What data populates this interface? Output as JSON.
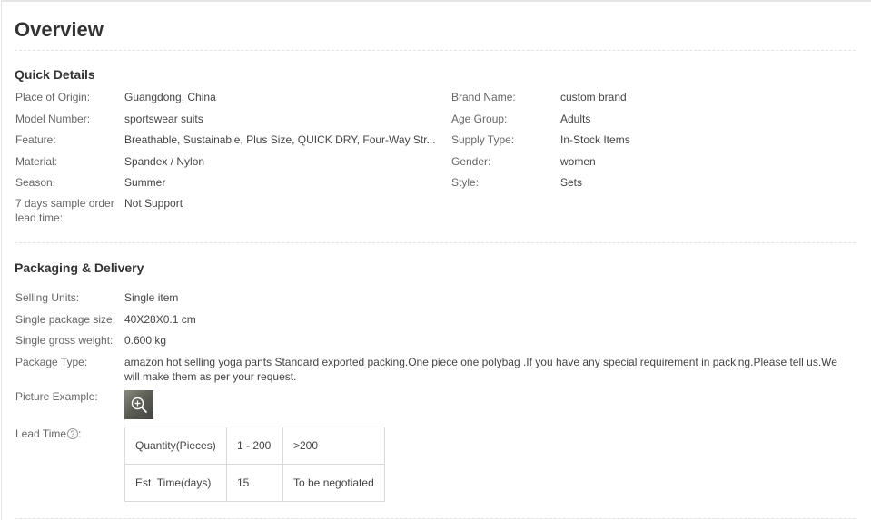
{
  "overview_title": "Overview",
  "quick_details": {
    "heading": "Quick Details",
    "left": [
      {
        "label": "Place of Origin:",
        "value": "Guangdong, China"
      },
      {
        "label": "Model Number:",
        "value": "sportswear suits"
      },
      {
        "label": "Feature:",
        "value": "Breathable, Sustainable, Plus Size, QUICK DRY, Four-Way Str..."
      },
      {
        "label": "Material:",
        "value": "Spandex / Nylon"
      },
      {
        "label": "Season:",
        "value": "Summer"
      },
      {
        "label": "7 days sample order lead time:",
        "value": "Not Support"
      }
    ],
    "right": [
      {
        "label": "Brand Name:",
        "value": "custom brand"
      },
      {
        "label": "Age Group:",
        "value": "Adults"
      },
      {
        "label": "Supply Type:",
        "value": "In-Stock Items"
      },
      {
        "label": "Gender:",
        "value": "women"
      },
      {
        "label": "Style:",
        "value": "Sets"
      }
    ]
  },
  "packaging": {
    "heading": "Packaging & Delivery",
    "rows": [
      {
        "label": "Selling Units:",
        "value": "Single item"
      },
      {
        "label": "Single package size:",
        "value": "40X28X0.1 cm"
      },
      {
        "label": "Single gross weight:",
        "value": "0.600 kg"
      },
      {
        "label": "Package Type:",
        "value": "amazon hot selling yoga pants Standard exported packing.One piece one polybag .If you have any special requirement in packing.Please tell us.We will make them as per your request."
      }
    ],
    "picture_label": "Picture Example:",
    "picture_icon": "zoom-in-icon",
    "lead_time_label": "Lead Time",
    "help_icon": "help-circle-icon",
    "help_glyph": "?",
    "lead_time_table": {
      "row1": [
        "Quantity(Pieces)",
        "1 - 200",
        ">200"
      ],
      "row2": [
        "Est. Time(days)",
        "15",
        "To be negotiated"
      ]
    }
  }
}
